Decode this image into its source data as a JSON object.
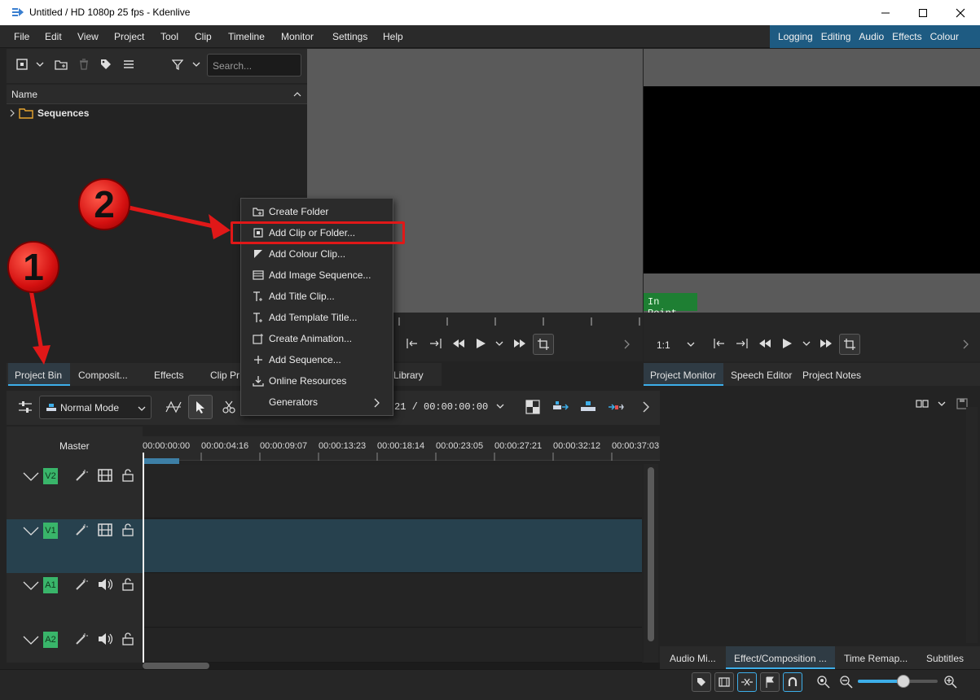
{
  "window": {
    "title": "Untitled / HD 1080p 25 fps - Kdenlive",
    "controls": [
      "minimize-icon",
      "maximize-icon",
      "close-icon"
    ]
  },
  "menubar": {
    "items": [
      "File",
      "Edit",
      "View",
      "Project",
      "Tool",
      "Clip",
      "Timeline",
      "Monitor",
      "Settings",
      "Help"
    ]
  },
  "layouts": {
    "items": [
      "Logging",
      "Editing",
      "Audio",
      "Effects",
      "Colour"
    ],
    "accent": "#1e5b82"
  },
  "bin": {
    "search_placeholder": "Search...",
    "column_header": "Name",
    "tree": [
      {
        "label": "Sequences"
      }
    ]
  },
  "left_tabs": [
    "Project Bin",
    "Composit...",
    "Effects",
    "Clip Pr",
    "Library"
  ],
  "project_monitor": {
    "in_point_label": "In Point",
    "zoom": "1:1",
    "tabs": [
      "Project Monitor",
      "Speech Editor",
      "Project Notes"
    ]
  },
  "timeline": {
    "mode": "Normal Mode",
    "timecode": "21 / 00:00:00:00",
    "master_label": "Master",
    "ruler": [
      "00:00:00:00",
      "00:00:04:16",
      "00:00:09:07",
      "00:00:13:23",
      "00:00:18:14",
      "00:00:23:05",
      "00:00:27:21",
      "00:00:32:12",
      "00:00:37:03"
    ],
    "tracks": [
      "V2",
      "V1",
      "A1",
      "A2"
    ]
  },
  "right_tabs": [
    "Audio Mi...",
    "Effect/Composition ...",
    "Time Remap...",
    "Subtitles"
  ],
  "context_menu": {
    "items": [
      {
        "label": "Create Folder",
        "icon": "folder-add-icon"
      },
      {
        "label": "Add Clip or Folder...",
        "icon": "add-clip-icon"
      },
      {
        "label": "Add Colour Clip...",
        "icon": "colour-clip-icon"
      },
      {
        "label": "Add Image Sequence...",
        "icon": "image-sequence-icon"
      },
      {
        "label": "Add Title Clip...",
        "icon": "title-clip-icon"
      },
      {
        "label": "Add Template Title...",
        "icon": "template-title-icon"
      },
      {
        "label": "Create Animation...",
        "icon": "animation-icon"
      },
      {
        "label": "Add Sequence...",
        "icon": "plus-icon"
      },
      {
        "label": "Online Resources",
        "icon": "download-icon"
      },
      {
        "label": "Generators",
        "icon": "chevron-right-icon"
      }
    ],
    "highlighted": "Add Clip or Folder...",
    "highlight_color": "#e01818"
  },
  "callouts": [
    "1",
    "2"
  ]
}
